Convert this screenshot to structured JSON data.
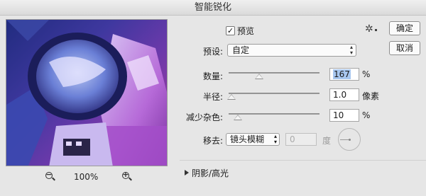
{
  "window": {
    "title": "智能锐化"
  },
  "preview_panel": {
    "zoom": "100%"
  },
  "options": {
    "preview_checkbox": {
      "label": "预览",
      "checked": true
    },
    "preset": {
      "label": "预设:",
      "value": "自定"
    },
    "amount": {
      "label": "数量:",
      "value": "167",
      "unit": "%",
      "level": 0.334
    },
    "radius": {
      "label": "半径:",
      "value": "1.0",
      "unit": "像素",
      "level": 0.03
    },
    "noise": {
      "label": "减少杂色:",
      "value": "10",
      "unit": "%",
      "level": 0.1
    },
    "remove": {
      "label": "移去:",
      "value": "镜头模糊",
      "angle_value": "0",
      "angle_unit": "度"
    },
    "shadows_highlights": {
      "label": "阴影/高光"
    }
  },
  "buttons": {
    "ok": "确定",
    "cancel": "取消"
  }
}
